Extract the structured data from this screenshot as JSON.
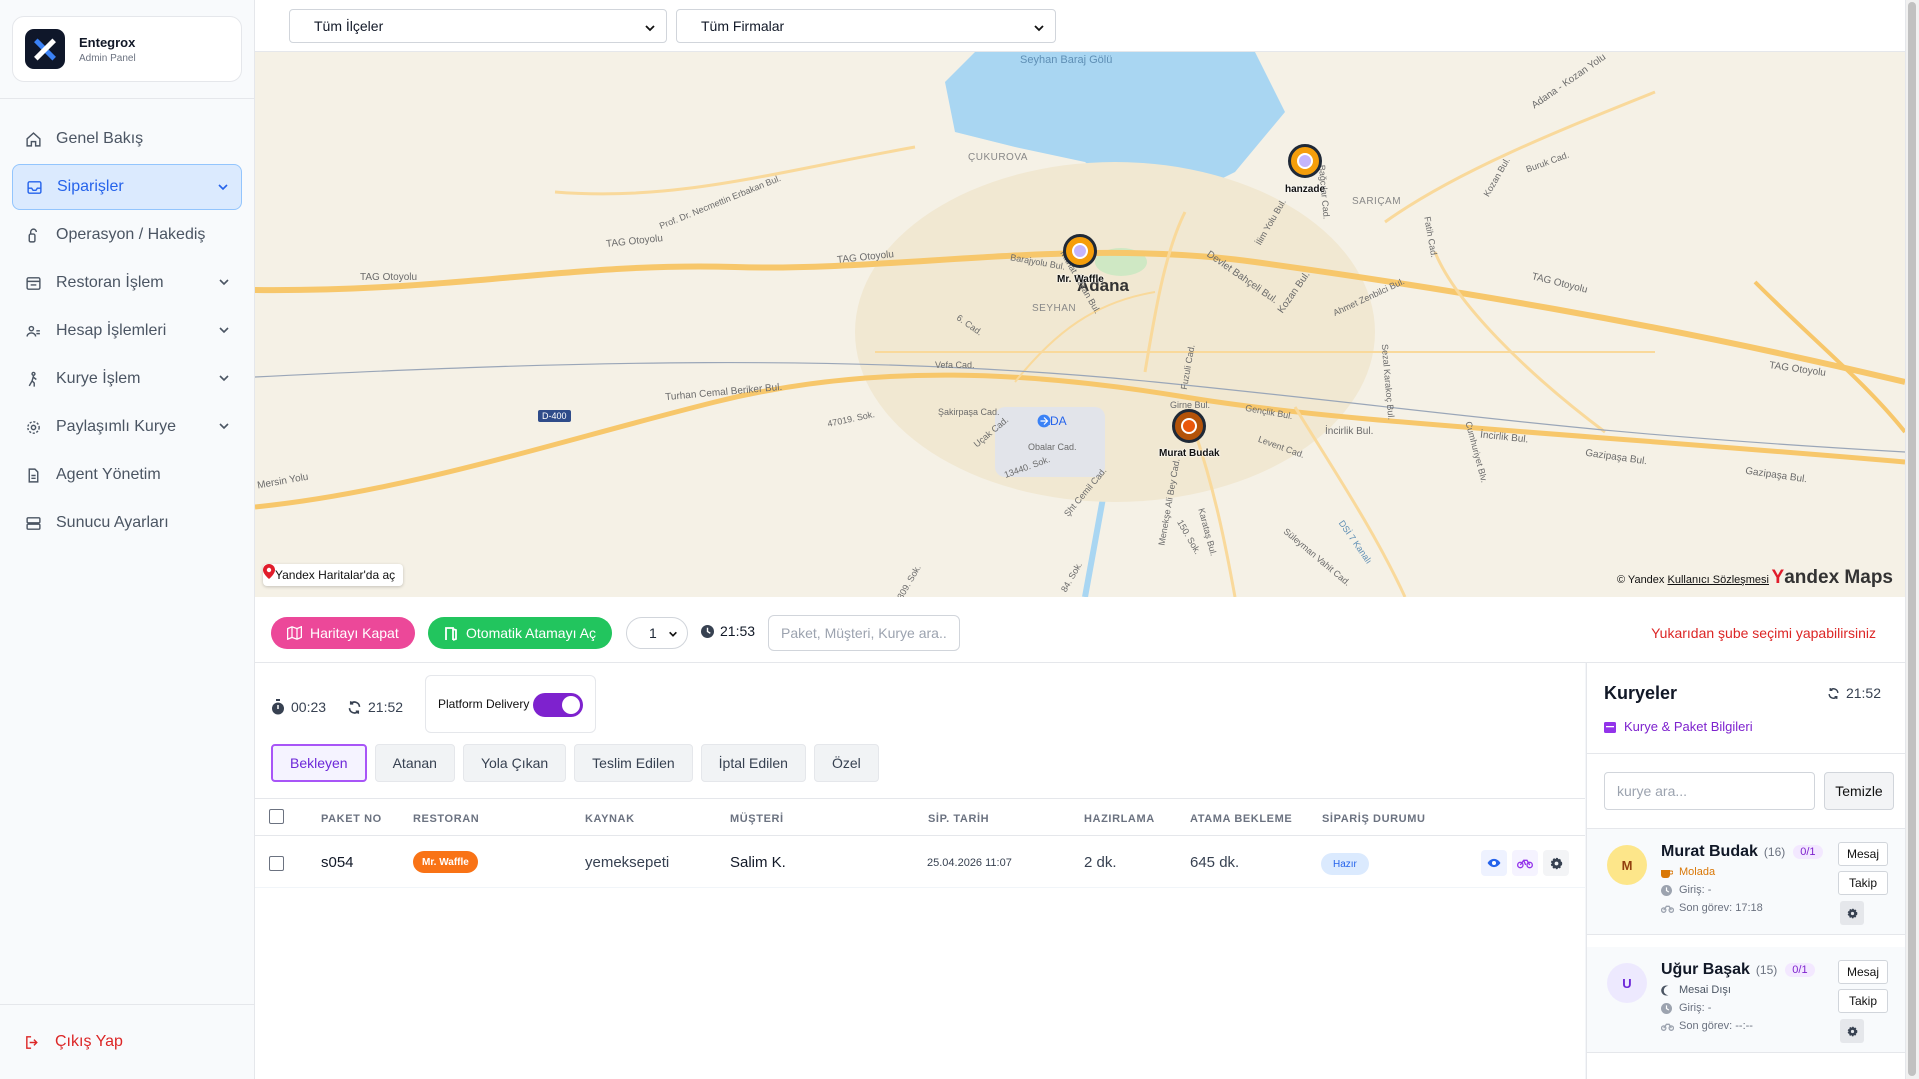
{
  "brand": {
    "name": "Entegrox",
    "subtitle": "Admin Panel"
  },
  "sidebar": {
    "items": [
      {
        "label": "Genel Bakış",
        "icon": "home-icon"
      },
      {
        "label": "Siparişler",
        "icon": "inbox-icon",
        "active": true,
        "expandable": true
      },
      {
        "label": "Operasyon / Hakediş",
        "icon": "lock-icon"
      },
      {
        "label": "Restoran İşlem",
        "icon": "list-icon",
        "expandable": true
      },
      {
        "label": "Hesap İşlemleri",
        "icon": "people-icon",
        "expandable": true
      },
      {
        "label": "Kurye İşlem",
        "icon": "walker-icon",
        "expandable": true
      },
      {
        "label": "Paylaşımlı Kurye",
        "icon": "gear-icon",
        "expandable": true
      },
      {
        "label": "Agent Yönetim",
        "icon": "document-icon"
      },
      {
        "label": "Sunucu Ayarları",
        "icon": "server-icon"
      }
    ],
    "logout": "Çıkış Yap"
  },
  "filters": {
    "district": "Tüm İlçeler",
    "company": "Tüm Firmalar"
  },
  "map": {
    "city": "Adana",
    "districts": [
      "ÇUKUROVA",
      "SARIÇAM",
      "SEYHAN"
    ],
    "water": "Seyhan Baraj Gölü",
    "roads": [
      "TAG Otoyolu",
      "TAG Otoyolu",
      "TAG Otoyolu",
      "TAG Otoyolu",
      "TAG Otoyolu",
      "Turhan Cemal Beriker Bul.",
      "İncirlik Bul.",
      "İncirlik Bul.",
      "Gazipaşa Bul.",
      "Gazipaşa Bul.",
      "Mersin Yolu",
      "Prof. Dr. Necmettin Erbakan Bul.",
      "Adana - Kozan Yolu",
      "Devlet Bahçeli Bul.",
      "Ahmet Zenbilci Bul.",
      "Kozan Bul.",
      "Vefa Cad.",
      "Şakirpaşa Cad.",
      "Obalar Cad.",
      "Levent Cad.",
      "Karataş Bul.",
      "Süleyman Vahit Cad.",
      "DSİ 7 Kanalı",
      "İlim Yolu Bul.",
      "Fatih Cad.",
      "Buruk Cad.",
      "Sezal Karakoç Bul.",
      "Gençlik Bul.",
      "Mithat Özsan Bul.",
      "Fuzuli Cad.",
      "Uçak Cad.",
      "Şht Cemil Cad.",
      "Menekşe Ali Bey Cad.",
      "13440. Sok.",
      "47019. Sok.",
      "6. Cad.",
      "150. Sok.",
      "84. Sok.",
      "309. Sok.",
      "Girne Bul.",
      "Cumhuriyet Blv.",
      "Bağcılar Cad.",
      "Kozan Bul.",
      "Barajyolu Bul."
    ],
    "airport": "ADA",
    "road_shield": "D-400",
    "markers": [
      {
        "label": "hanzade",
        "kind": "restaurant"
      },
      {
        "label": "Mr. Waffle",
        "kind": "restaurant"
      },
      {
        "label": "Murat Budak",
        "kind": "courier"
      }
    ],
    "open_link": "Yandex Haritalar'da aç",
    "copyright": "© Yandex",
    "terms": "Kullanıcı Sözleşmesi",
    "brand_y": "Y",
    "brand_rest": "andex Maps"
  },
  "toolbar": {
    "close_map": "Haritayı Kapat",
    "auto_assign": "Otomatik Atamayı Aç",
    "count_value": "1",
    "time": "21:53",
    "search_placeholder": "Paket, Müşteri, Kurye ara..",
    "hint": "Yukarıdan şube seçimi yapabilirsiniz"
  },
  "orders": {
    "timer": "00:23",
    "refresh_time": "21:52",
    "platform_label": "Platform Delivery",
    "platform_on": true,
    "tabs": [
      "Bekleyen",
      "Atanan",
      "Yola Çıkan",
      "Teslim Edilen",
      "İptal Edilen",
      "Özel"
    ],
    "active_tab": "Bekleyen",
    "columns": [
      "PAKET NO",
      "RESTORAN",
      "KAYNAK",
      "MÜŞTERİ",
      "SİP. TARİH",
      "HAZIRLAMA",
      "ATAMA BEKLEME",
      "SİPARİŞ DURUMU"
    ],
    "rows": [
      {
        "package": "s054",
        "restaurant": "Mr. Waffle",
        "source": "yemeksepeti",
        "customer": "Salim K.",
        "date": "25.04.2026 11:07",
        "prep": "2 dk.",
        "wait": "645 dk.",
        "status": "Hazır"
      }
    ]
  },
  "couriers": {
    "title": "Kuryeler",
    "time": "21:52",
    "info_link": "Kurye & Paket Bilgileri",
    "search_placeholder": "kurye ara...",
    "clear_label": "Temizle",
    "message_label": "Mesaj",
    "track_label": "Takip",
    "list": [
      {
        "initial": "M",
        "name": "Murat Budak",
        "count": "(16)",
        "fraction": "0/1",
        "status": "Molada",
        "status_color": "#d97706",
        "login": "Giriş: -",
        "last_task": "Son görev: 17:18",
        "avatar_bg": "#fde68a",
        "avatar_fg": "#92400e"
      },
      {
        "initial": "U",
        "name": "Uğur Başak",
        "count": "(15)",
        "fraction": "0/1",
        "status": "Mesai Dışı",
        "status_color": "#4b5563",
        "login": "Giriş: -",
        "last_task": "Son görev: --:--",
        "avatar_bg": "#ede9fe",
        "avatar_fg": "#6d28d9"
      }
    ]
  }
}
